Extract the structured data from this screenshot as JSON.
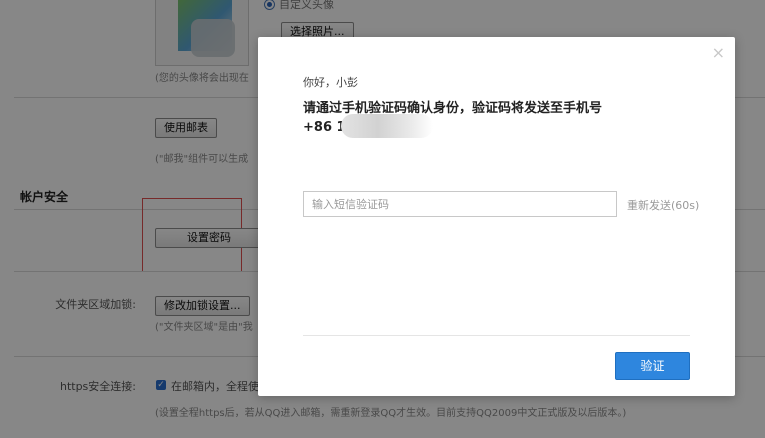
{
  "background": {
    "avatar": {
      "radio_label": "自定义头像",
      "choose_button": "选择照片...",
      "hint": "(您的头像将会出现在"
    },
    "widget": {
      "button": "使用邮表",
      "hint": "(\"邮我\"组件可以生成"
    },
    "security": {
      "section_title": "帐户安全",
      "set_password_button": "设置密码"
    },
    "folder": {
      "label": "文件夹区域加锁:",
      "button": "修改加锁设置...",
      "hint": "(\"文件夹区域\"是由\"我"
    },
    "https": {
      "label": "https安全连接:",
      "checkbox_label": "在邮箱内，全程使",
      "hint": "(设置全程https后，若从QQ进入邮箱，需重新登录QQ才生效。目前支持QQ2009中文正式版及以后版本。)"
    }
  },
  "modal": {
    "close": "×",
    "greeting": "你好，小彭",
    "title": "请通过手机验证码确认身份，验证码将发送至手机号",
    "phone_prefix": "+86 18",
    "code_placeholder": "输入短信验证码",
    "resend": "重新发送(60s)",
    "verify_button": "验证"
  },
  "colors": {
    "overlay": "#000000",
    "primary": "#2e86de",
    "highlight": "#e05050"
  }
}
